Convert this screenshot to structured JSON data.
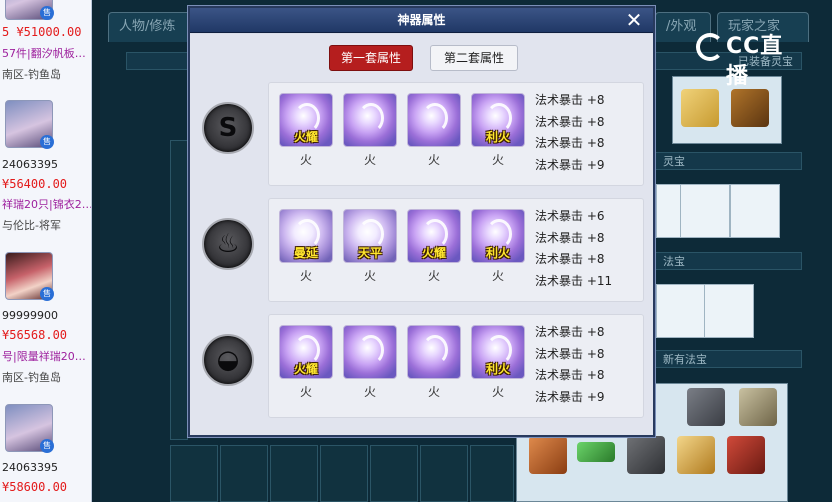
{
  "dialog": {
    "title": "神器属性",
    "close_label": "✕",
    "tabs": [
      "第一套属性",
      "第二套属性"
    ],
    "active_tab": 0,
    "sets": [
      {
        "emblem": "s-rune-icon",
        "emblem_glyph": "S",
        "gems": [
          {
            "label": "火耀",
            "element": "火"
          },
          {
            "label": "",
            "element": "火"
          },
          {
            "label": "",
            "element": "火"
          },
          {
            "label": "利火",
            "element": "火"
          }
        ],
        "stats": [
          "法术暴击 +8",
          "法术暴击 +8",
          "法术暴击 +8",
          "法术暴击 +9"
        ]
      },
      {
        "emblem": "flame-rune-icon",
        "emblem_glyph": "♨",
        "gems": [
          {
            "label": "曼延",
            "element": "火"
          },
          {
            "label": "天平",
            "element": "火"
          },
          {
            "label": "火耀",
            "element": "火"
          },
          {
            "label": "利火",
            "element": "火"
          }
        ],
        "stats": [
          "法术暴击 +6",
          "法术暴击 +8",
          "法术暴击 +8",
          "法术暴击 +11"
        ]
      },
      {
        "emblem": "cauldron-rune-icon",
        "emblem_glyph": "◒",
        "gems": [
          {
            "label": "火耀",
            "element": "火"
          },
          {
            "label": "",
            "element": "火"
          },
          {
            "label": "",
            "element": "火"
          },
          {
            "label": "利火",
            "element": "火"
          }
        ],
        "stats": [
          "法术暴击 +8",
          "法术暴击 +8",
          "法术暴击 +8",
          "法术暴击 +9"
        ]
      }
    ]
  },
  "background": {
    "tabs": [
      "人物/修炼",
      "/外观",
      "玩家之家"
    ],
    "headers": [
      "已装备灵宝",
      "灵宝",
      "法宝",
      "新有法宝"
    ]
  },
  "listings": [
    {
      "lines": [
        "5  ¥51000.00",
        "57件|翻汐帆板…",
        "南区-钓鱼岛"
      ],
      "sell_badge": "售"
    },
    {
      "lines": [
        "24063395",
        "¥56400.00",
        "祥瑞20只|锦衣2…",
        "与伦比-将军"
      ],
      "sell_badge": "售"
    },
    {
      "lines": [
        "99999900",
        "¥56568.00",
        "号|限量祥瑞20…",
        "南区-钓鱼岛"
      ],
      "sell_badge": "售"
    },
    {
      "lines": [
        "24063395",
        "¥58600.00"
      ],
      "sell_badge": "售"
    }
  ],
  "watermark": {
    "brand": "CC直播"
  },
  "colors": {
    "active_tab": "#b51e1e",
    "gem_label": "#ffe62e",
    "price": "#e31b1b",
    "dialog_title_bar": "#203866"
  }
}
